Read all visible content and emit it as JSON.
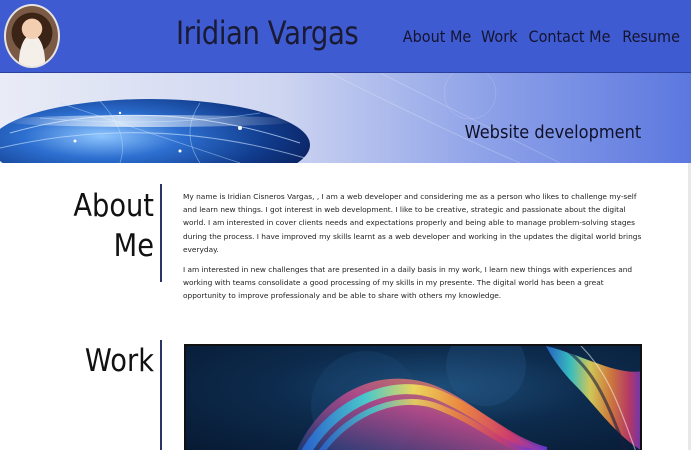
{
  "header": {
    "title": "Iridian Vargas",
    "avatar_alt": "Profile photo",
    "nav": [
      {
        "label": "About Me"
      },
      {
        "label": "Work"
      },
      {
        "label": "Contact Me"
      },
      {
        "label": "Resume"
      }
    ]
  },
  "banner": {
    "caption": "Website development"
  },
  "about": {
    "heading_line1": "About",
    "heading_line2": "Me",
    "paragraphs": [
      "My name is Iridian Cisneros Vargas, , I am a web developer and considering me as a person who likes to challenge my-self and learn new things. I got interest in web development. I like to be creative, strategic and passionate about the digital world. I am interested in cover clients needs and expectations properly and being able to manage problem-solving stages during the process. I have improved my skills learnt as a web developer and working in the updates the digital world brings everyday.",
      "I am interested in new challenges that are presented in a daily basis in my work, I learn new things with experiences and working with teams consolidate a good processing of my skills in my presente. The digital world has been a great opportunity to improve professionaly and be able to share with others my knowledge."
    ]
  },
  "work": {
    "heading": "Work"
  },
  "colors": {
    "header_bg": "#3f5bd2",
    "heading_text": "#111111",
    "divider": "#2a3466"
  }
}
